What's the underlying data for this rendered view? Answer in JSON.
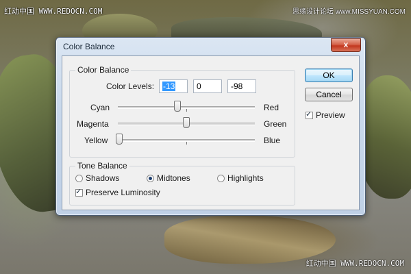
{
  "watermarks": {
    "top_left": "红动中国 WWW.REDOCN.COM",
    "top_right": "思缘设计论坛 www.MISSYUAN.COM",
    "bottom_right": "红动中国 WWW.REDOCN.COM"
  },
  "window": {
    "title": "Color Balance",
    "close_glyph": "x"
  },
  "color_balance": {
    "group_label": "Color Balance",
    "levels_label": "Color Levels:",
    "levels": [
      "-13",
      "0",
      "-98"
    ],
    "sliders": [
      {
        "left": "Cyan",
        "right": "Red",
        "value": -13
      },
      {
        "left": "Magenta",
        "right": "Green",
        "value": 0
      },
      {
        "left": "Yellow",
        "right": "Blue",
        "value": -98
      }
    ]
  },
  "tone_balance": {
    "group_label": "Tone Balance",
    "options": [
      "Shadows",
      "Midtones",
      "Highlights"
    ],
    "selected": "Midtones",
    "preserve_luminosity_label": "Preserve Luminosity",
    "preserve_luminosity": true
  },
  "buttons": {
    "ok": "OK",
    "cancel": "Cancel",
    "preview_label": "Preview",
    "preview": true
  },
  "colors": {
    "close_button": "#c2371f",
    "selection": "#3399ff",
    "default_button_border": "#3c7fb1"
  }
}
